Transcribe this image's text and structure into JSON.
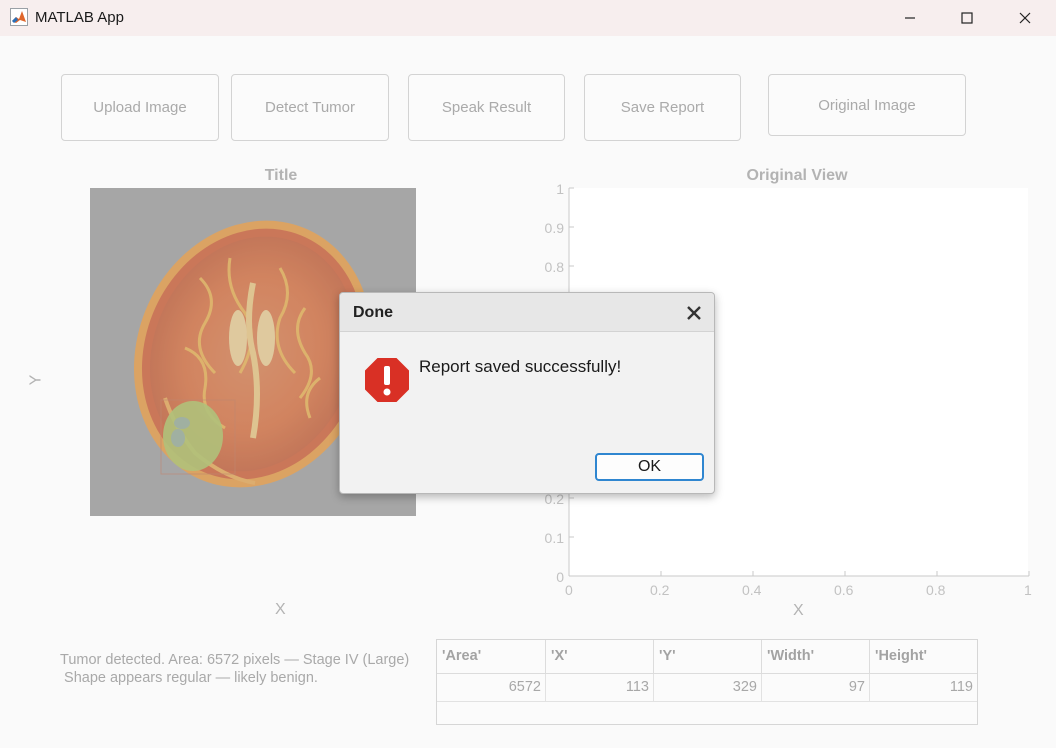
{
  "window": {
    "title": "MATLAB App"
  },
  "toolbar": {
    "upload_label": "Upload Image",
    "detect_label": "Detect Tumor",
    "speak_label": "Speak Result",
    "save_label": "Save Report",
    "original_label": "Original Image"
  },
  "left_axes": {
    "title": "Title",
    "xlabel": "X",
    "ylabel": "Y"
  },
  "right_axes": {
    "title": "Original View",
    "xlabel": "X",
    "xticks": [
      "0",
      "0.2",
      "0.4",
      "0.6",
      "0.8",
      "1"
    ],
    "yticks": [
      "0",
      "0.1",
      "0.2",
      "0.8",
      "0.9",
      "1"
    ]
  },
  "status": {
    "line1": "Tumor detected. Area: 6572 pixels — Stage IV (Large)",
    "line2": " Shape appears regular — likely benign."
  },
  "table": {
    "headers": [
      "'Area'",
      "'X'",
      "'Y'",
      "'Width'",
      "'Height'"
    ],
    "row": [
      "6572",
      "113",
      "329",
      "97",
      "119"
    ]
  },
  "dialog": {
    "title": "Done",
    "message": "Report saved successfully!",
    "ok_label": "OK",
    "icon": "error-stop-icon"
  },
  "colors": {
    "accent": "#2f86d0",
    "error_icon": "#d93025",
    "tumor_overlay": "#b5cc6a"
  }
}
